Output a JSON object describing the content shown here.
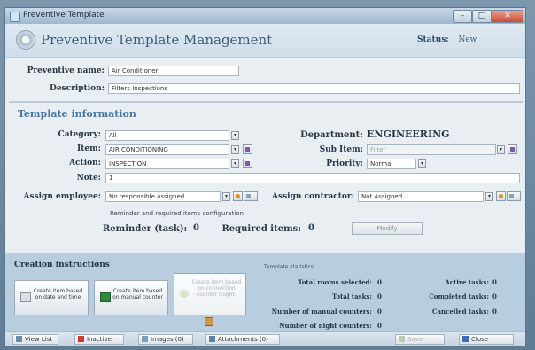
{
  "window": {
    "title": "Preventive Template"
  },
  "header": {
    "title": "Preventive Template Management",
    "status_label": "Status:",
    "status_value": "New"
  },
  "form": {
    "name_label": "Preventive name:",
    "name_value": "Air Conditioner",
    "description_label": "Description:",
    "description_value": "Filters Inspections"
  },
  "template_info": {
    "section_title": "Template information",
    "category_label": "Category:",
    "category_value": "All",
    "item_label": "Item:",
    "item_value": "AIR CONDITIONING",
    "action_label": "Action:",
    "action_value": "INSPECTION",
    "department_label": "Department:",
    "department_value": "ENGINEERING",
    "subitem_label": "Sub Item:",
    "subitem_value": "Filter",
    "priority_label": "Priority:",
    "priority_value": "Normal",
    "note_label": "Note:",
    "note_value": "1",
    "assign_employee_label": "Assign employee:",
    "assign_employee_value": "No responsible assigned",
    "assign_contractor_label": "Assign contractor:",
    "assign_contractor_value": "Not Assigned",
    "reminder_caption": "Reminder and required items configuration",
    "reminder_label": "Reminder (task):",
    "reminder_value": "0",
    "required_label": "Required items:",
    "required_value": "0",
    "modify_label": "Modify"
  },
  "creation": {
    "section_title": "Creation instructions",
    "buttons": [
      {
        "label": "Create item based on date and time"
      },
      {
        "label": "Create item based on manual counter"
      },
      {
        "label": "Create item based on connection counter (night)"
      }
    ],
    "stats_title": "Template statistics",
    "stats_left": [
      {
        "label": "Total rooms selected:",
        "value": "0"
      },
      {
        "label": "Total tasks:",
        "value": "0"
      },
      {
        "label": "Number of manual counters:",
        "value": "0"
      },
      {
        "label": "Number of night counters:",
        "value": "0"
      }
    ],
    "stats_right": [
      {
        "label": "Active tasks:",
        "value": "0"
      },
      {
        "label": "Completed tasks:",
        "value": "0"
      },
      {
        "label": "Cancelled tasks:",
        "value": "0"
      }
    ]
  },
  "footer": {
    "view_list": "View List",
    "inactive": "Inactive",
    "images": "Images (0)",
    "attachments": "Attachments (0)",
    "save": "Save",
    "close": "Close"
  },
  "colors": {
    "accent": "#4a78a0",
    "title": "#3b5e7c",
    "bottom_panel": "#b8cddd"
  }
}
